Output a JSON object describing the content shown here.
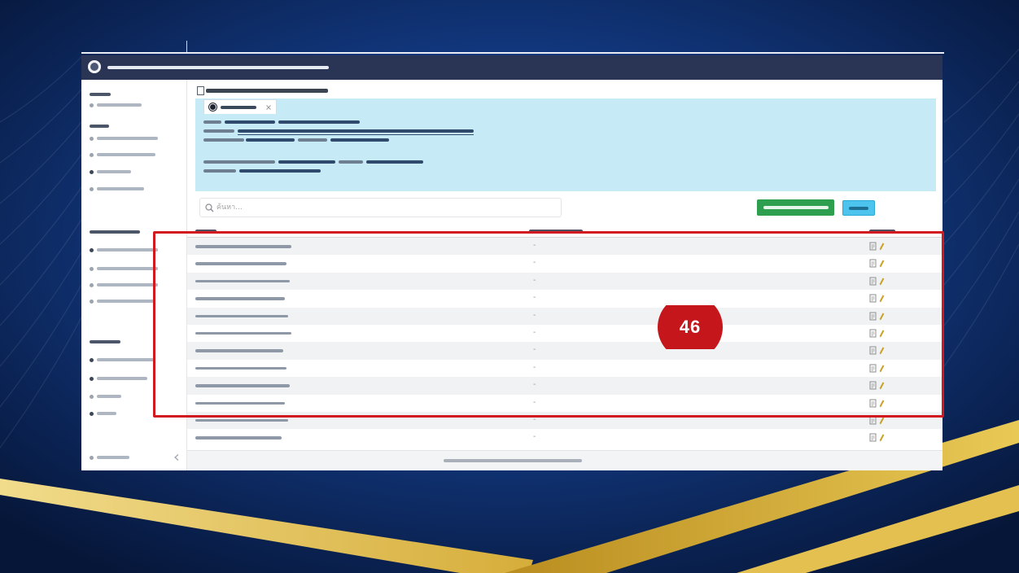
{
  "slide": {
    "badge_number": "46",
    "highlight_color": "#d11a1f",
    "badge_color": "#c5161c"
  },
  "app": {
    "header_color": "#2a3556",
    "info_box_color": "#c6eaf6",
    "search": {
      "placeholder": "ค้นหา...",
      "icon": "search-icon"
    },
    "buttons": {
      "primary_color": "#2e9e4f",
      "secondary_color": "#4cc4ee"
    },
    "table": {
      "rows": [
        {
          "value": "-"
        },
        {
          "value": "-"
        },
        {
          "value": "-"
        },
        {
          "value": "-"
        },
        {
          "value": "-"
        },
        {
          "value": "-"
        },
        {
          "value": "-"
        },
        {
          "value": "-"
        },
        {
          "value": "-"
        },
        {
          "value": "-"
        },
        {
          "value": "-"
        },
        {
          "value": "-"
        }
      ],
      "row_action_icons": [
        "document-icon",
        "edit-icon"
      ]
    }
  },
  "icons": {
    "logo": "logo-icon",
    "tab": "dot-icon",
    "tab_close": "close-icon",
    "search": "search-icon",
    "sidebar_collapse": "chevron-left-icon"
  }
}
